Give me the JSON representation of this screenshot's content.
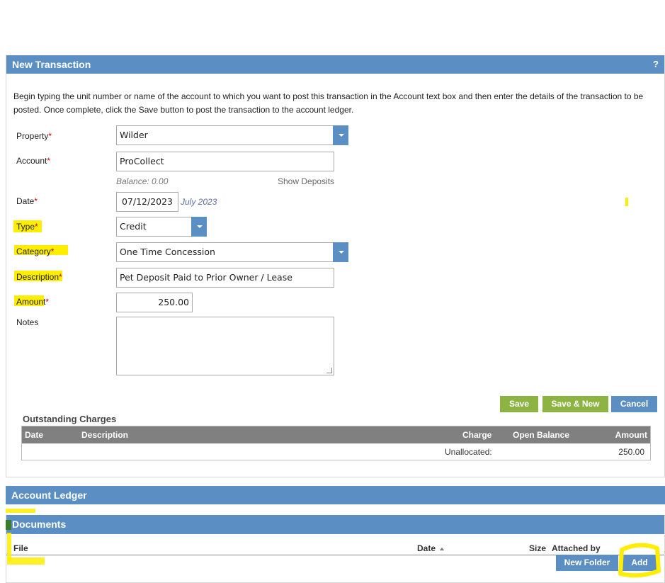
{
  "panel": {
    "title": "New Transaction",
    "help": "?"
  },
  "intro": "Begin typing the unit number or name of the account to which you want to post this transaction in the Account text box and then enter the details of the transaction to be posted. Once complete, click the Save button to post the transaction to the account ledger.",
  "fields": {
    "property": {
      "label": "Property",
      "value": "Wilder"
    },
    "account": {
      "label": "Account",
      "value": "ProCollect",
      "balance": "Balance: 0.00",
      "show_deposits": "Show Deposits"
    },
    "date": {
      "label": "Date",
      "value": "07/12/2023",
      "month": "July 2023"
    },
    "type": {
      "label": "Type",
      "value": "Credit"
    },
    "category": {
      "label": "Category",
      "value": "One Time Concession"
    },
    "description": {
      "label": "Description",
      "value": "Pet Deposit Paid to Prior Owner / Lease"
    },
    "amount": {
      "label": "Amount",
      "value": "250.00"
    },
    "notes": {
      "label": "Notes",
      "value": ""
    }
  },
  "required_mark": "*",
  "buttons": {
    "save": "Save",
    "save_new": "Save & New",
    "cancel": "Cancel"
  },
  "outstanding": {
    "title": "Outstanding Charges",
    "columns": [
      "Date",
      "Description",
      "Charge",
      "Open Balance",
      "Amount"
    ],
    "row": {
      "label": "Unallocated:",
      "amount": "250.00"
    }
  },
  "ledger": {
    "title": "Account Ledger"
  },
  "documents": {
    "title": "Documents",
    "columns": [
      "File",
      "Date",
      "Size",
      "Attached by"
    ],
    "new_folder": "New Folder",
    "add": "Add"
  },
  "colors": {
    "header": "#5b8fc3",
    "green_button": "#8db343",
    "highlight": "#ffee00"
  }
}
